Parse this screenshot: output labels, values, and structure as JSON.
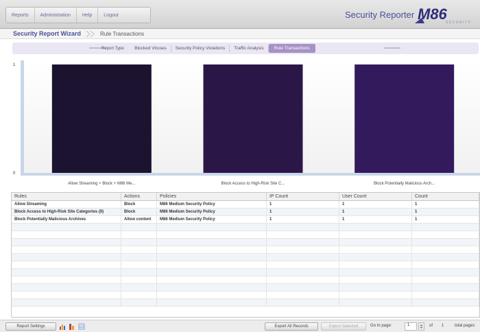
{
  "menu": {
    "items": [
      "Reports",
      "Administration",
      "Help",
      "Logout"
    ]
  },
  "brand": {
    "title": "Security Reporter",
    "logo_text": "M86",
    "logo_sub": "SECURITY"
  },
  "wizard": {
    "title": "Security Report Wizard",
    "current": "Rule Transactions"
  },
  "report_type": {
    "label": "Report Type:",
    "tabs": [
      "Blocked Viruses",
      "Security Policy Violations",
      "Traffic Analysis",
      "Rule Transactions"
    ],
    "active_index": 3
  },
  "chart_data": {
    "type": "bar",
    "categories": [
      "Allow Streaming + Block + M86 Me...",
      "Block Access to High-Risk Site C...",
      "Block Potentially Malicious Arch..."
    ],
    "values": [
      1,
      1,
      1
    ],
    "ylim": [
      0,
      1
    ],
    "y_ticks": [
      "1",
      "0"
    ],
    "colors": [
      "#1c1330",
      "#2a1748",
      "#331a5c"
    ]
  },
  "table": {
    "columns": [
      "Rules",
      "Actions",
      "Policies",
      "IP Count",
      "User Count",
      "Count"
    ],
    "rows": [
      [
        "Allow Streaming",
        "Block",
        "M86 Medium Security Policy",
        "1",
        "1",
        "1"
      ],
      [
        "Block Access to High-Risk Site Categories (II)",
        "Block",
        "M86 Medium Security Policy",
        "1",
        "1",
        "1"
      ],
      [
        "Block Potentially Malicious Archives",
        "Allow content",
        "M86 Medium Security Policy",
        "1",
        "1",
        "1"
      ]
    ],
    "empty_rows": 11
  },
  "footer": {
    "report_settings": "Report Settings",
    "export_all": "Export All Records",
    "export_selected": "Export Selected",
    "go_to_page": "Go to page:",
    "page_value": "1",
    "of_label": "of",
    "total": "1",
    "total_pages": "total pages"
  }
}
